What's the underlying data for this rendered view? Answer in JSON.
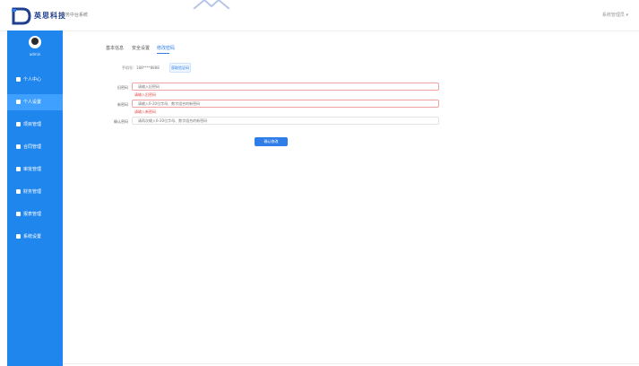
{
  "header": {
    "brand_name": "英思科技",
    "subtitle": "财务中台系统",
    "user_menu": "系统管理员 ▾"
  },
  "sidebar": {
    "username": "admin",
    "items": [
      {
        "label": "个人中心",
        "icon": "home-icon",
        "active": false
      },
      {
        "label": "个人设置",
        "icon": "user-icon",
        "active": true
      },
      {
        "label": "项目管理",
        "icon": "document-icon",
        "active": false
      },
      {
        "label": "合同管理",
        "icon": "contract-icon",
        "active": false
      },
      {
        "label": "审批管理",
        "icon": "approval-icon",
        "active": false
      },
      {
        "label": "财务管理",
        "icon": "finance-icon",
        "active": false
      },
      {
        "label": "报表管理",
        "icon": "report-icon",
        "active": false
      },
      {
        "label": "系统设置",
        "icon": "settings-icon",
        "active": false
      }
    ]
  },
  "tabs": [
    {
      "label": "基本信息",
      "active": false
    },
    {
      "label": "安全设置",
      "active": false
    },
    {
      "label": "修改密码",
      "active": true
    }
  ],
  "stats": {
    "text": "手机号：188****8888",
    "button_label": "获取验证码"
  },
  "form": {
    "fields": [
      {
        "label": "旧密码",
        "placeholder": "请输入旧密码",
        "error": "请输入旧密码"
      },
      {
        "label": "新密码",
        "placeholder": "请输入6-20位字母、数字组合的新密码",
        "error": "请输入新密码"
      },
      {
        "label": "确认密码",
        "placeholder": "请再次输入6-20位字母、数字组合的新密码",
        "error": ""
      }
    ],
    "submit_label": "确认修改"
  },
  "colors": {
    "sidebar_bg": "#1f86ee",
    "sidebar_active": "#3fa0ff",
    "accent": "#2f7de8",
    "error": "#e04848"
  }
}
